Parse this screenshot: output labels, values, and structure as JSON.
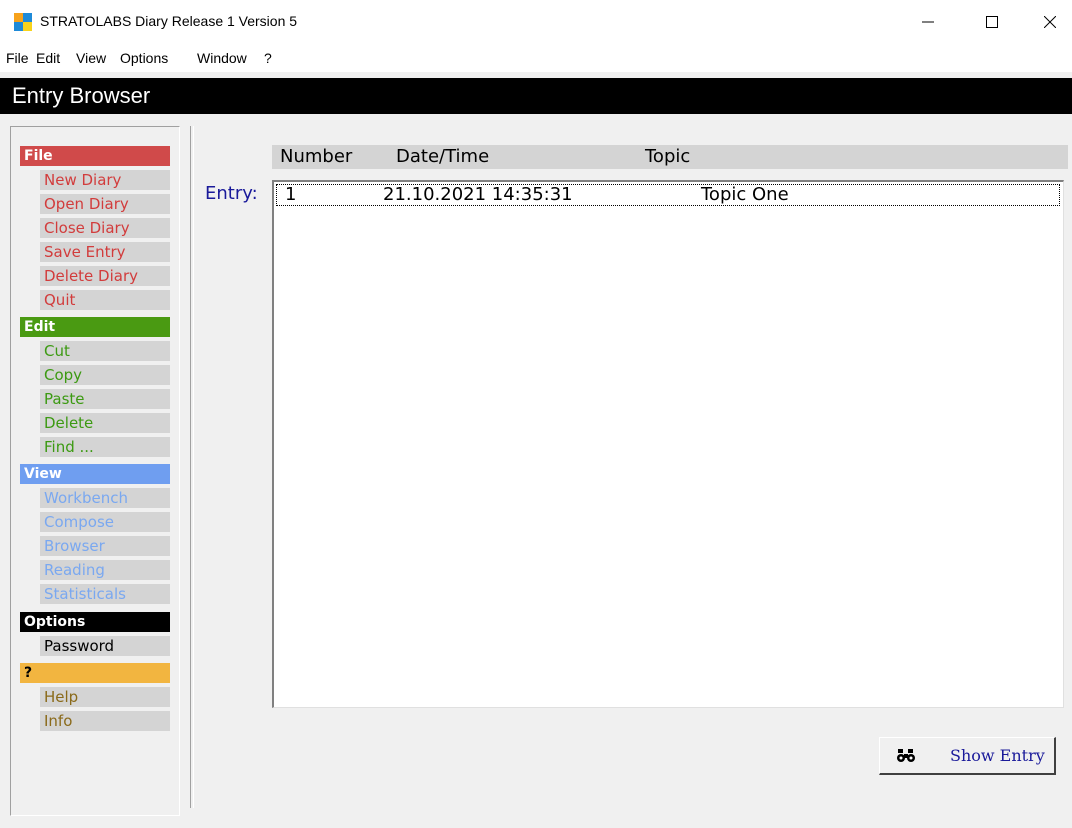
{
  "window": {
    "title": "STRATOLABS Diary Release 1 Version 5",
    "logo_colors": [
      "#f7a21b",
      "#1e8ad8",
      "#1e8ad8",
      "#f7d31b"
    ],
    "minimize_glyph": "—",
    "maximize_glyph": "☐",
    "close_glyph": "✕"
  },
  "menubar": [
    {
      "label": "File"
    },
    {
      "label": "Edit"
    },
    {
      "label": "View"
    },
    {
      "label": "Options"
    },
    {
      "label": "Window"
    },
    {
      "label": "?"
    }
  ],
  "header": {
    "title": "Entry Browser"
  },
  "nav": {
    "file": {
      "title": "File",
      "color": "#d04a4a",
      "items": [
        "New Diary",
        "Open Diary",
        "Close Diary",
        "Save Entry",
        "Delete Diary",
        "Quit"
      ]
    },
    "edit": {
      "title": "Edit",
      "color": "#4a9a12",
      "items": [
        "Cut",
        "Copy",
        "Paste",
        "Delete",
        "Find ..."
      ]
    },
    "view": {
      "title": "View",
      "color": "#6f9ef0",
      "items": [
        "Workbench",
        "Compose",
        "Browser",
        "Reading",
        "Statisticals"
      ]
    },
    "options": {
      "title": "Options",
      "color": "#000000",
      "items": [
        "Password"
      ]
    },
    "help": {
      "title": "?",
      "color": "#f2b540",
      "items": [
        "Help",
        "Info"
      ]
    }
  },
  "browser": {
    "columns": [
      "Number",
      "Date/Time",
      "Topic"
    ],
    "entry_label": "Entry:",
    "rows": [
      {
        "number": "1",
        "datetime": "21.10.2021 14:35:31",
        "topic": "Topic One"
      }
    ]
  },
  "show_entry": {
    "label": "Show Entry",
    "icon": "binoculars-icon"
  }
}
